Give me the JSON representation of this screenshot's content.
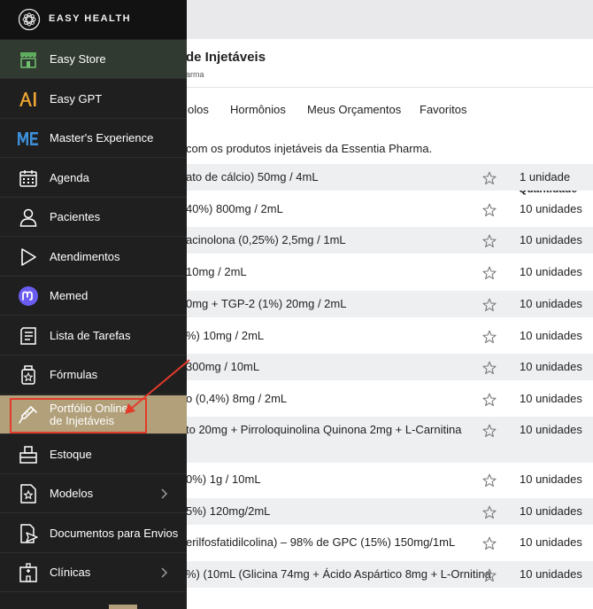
{
  "app": {
    "brand_name": "EASY HEALTH"
  },
  "page": {
    "title": "de Injetáveis",
    "subtitle": "arma",
    "intro": "com os produtos injetáveis da Essentia Pharma.",
    "tabs": [
      {
        "label": "olos"
      },
      {
        "label": "Hormônios"
      },
      {
        "label": "Meus Orçamentos"
      },
      {
        "label": "Favoritos"
      }
    ],
    "table": {
      "quantity_header": "Quantidade",
      "rows": [
        {
          "name": "ato de cálcio) 50mg / 4mL",
          "quantity": "1 unidade"
        },
        {
          "name": "40%) 800mg / 2mL",
          "quantity": "10 unidades"
        },
        {
          "name": "acinolona (0,25%) 2,5mg / 1mL",
          "quantity": "10 unidades"
        },
        {
          "name": "10mg / 2mL",
          "quantity": "10 unidades"
        },
        {
          "name": "0mg + TGP-2 (1%) 20mg / 2mL",
          "quantity": "10 unidades"
        },
        {
          "name": "%) 10mg / 2mL",
          "quantity": "10 unidades"
        },
        {
          "name": "300mg / 10mL",
          "quantity": "10 unidades"
        },
        {
          "name": "o (0,4%) 8mg / 2mL",
          "quantity": "10 unidades"
        },
        {
          "name": "to 20mg + Pirroloquinolina Quinona 2mg + L-Carnitina",
          "quantity": "10 unidades"
        },
        {
          "name": "0%) 1g / 10mL",
          "quantity": "10 unidades"
        },
        {
          "name": "5%) 120mg/2mL",
          "quantity": "10 unidades"
        },
        {
          "name": "erilfosfatidilcolina) – 98% de GPC (15%) 150mg/1mL",
          "quantity": "10 unidades"
        },
        {
          "name": "%) (10mL (Glicina 74mg + Ácido Aspártico 8mg + L-Ornitina",
          "quantity": "10 unidades"
        }
      ]
    }
  },
  "sidebar": {
    "items": [
      {
        "label": "Easy Store",
        "icon": "store-icon"
      },
      {
        "label": "Easy GPT",
        "icon": "ai-icon"
      },
      {
        "label": "Master's Experience",
        "icon": "me-icon"
      },
      {
        "label": "Agenda",
        "icon": "calendar-icon"
      },
      {
        "label": "Pacientes",
        "icon": "user-icon"
      },
      {
        "label": "Atendimentos",
        "icon": "play-icon"
      },
      {
        "label": "Memed",
        "icon": "memed-icon"
      },
      {
        "label": "Lista de Tarefas",
        "icon": "checklist-icon"
      },
      {
        "label": "Fórmulas",
        "icon": "bottle-icon"
      },
      {
        "label": "Portfólio Online de Injetáveis",
        "icon": "syringe-icon",
        "active": true
      },
      {
        "label": "Estoque",
        "icon": "boxes-icon"
      },
      {
        "label": "Modelos",
        "icon": "template-icon",
        "has_submenu": true
      },
      {
        "label": "Documentos para Envios",
        "icon": "send-document-icon"
      },
      {
        "label": "Clínicas",
        "icon": "clinic-icon",
        "has_submenu": true
      }
    ]
  },
  "colors": {
    "sidebar_bg": "#1f1f1f",
    "active_item": "#b1a07a",
    "annotation_red": "#e23b2a",
    "row_alt": "#eeeff1"
  }
}
